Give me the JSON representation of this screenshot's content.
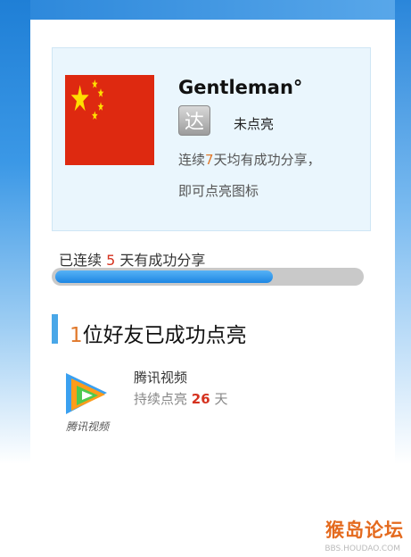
{
  "profile": {
    "username": "Gentleman°",
    "badge_char": "达",
    "badge_status": "未点亮",
    "tip_prefix": "连续",
    "tip_days": "7",
    "tip_suffix": "天均有成功分享，",
    "tip_line2": "即可点亮图标"
  },
  "streak": {
    "prefix": "已连续",
    "days": "5",
    "suffix": "天有成功分享",
    "progress_fraction": 0.714
  },
  "friends_section": {
    "count": "1",
    "title_suffix": "位好友已成功点亮"
  },
  "friends": [
    {
      "name": "腾讯视频",
      "days_prefix": "持续点亮",
      "days": "26",
      "days_suffix": "天",
      "logo_text": "腾讯视频",
      "icon": "tencent-video-logo"
    }
  ],
  "watermark": {
    "text": "猴岛论坛",
    "sub": "BBS.HOUDAO.COM"
  },
  "colors": {
    "accent_blue": "#49a7e8",
    "highlight_orange": "#e0782a",
    "highlight_red": "#d5321f",
    "card_bg": "#eaf6fd"
  }
}
